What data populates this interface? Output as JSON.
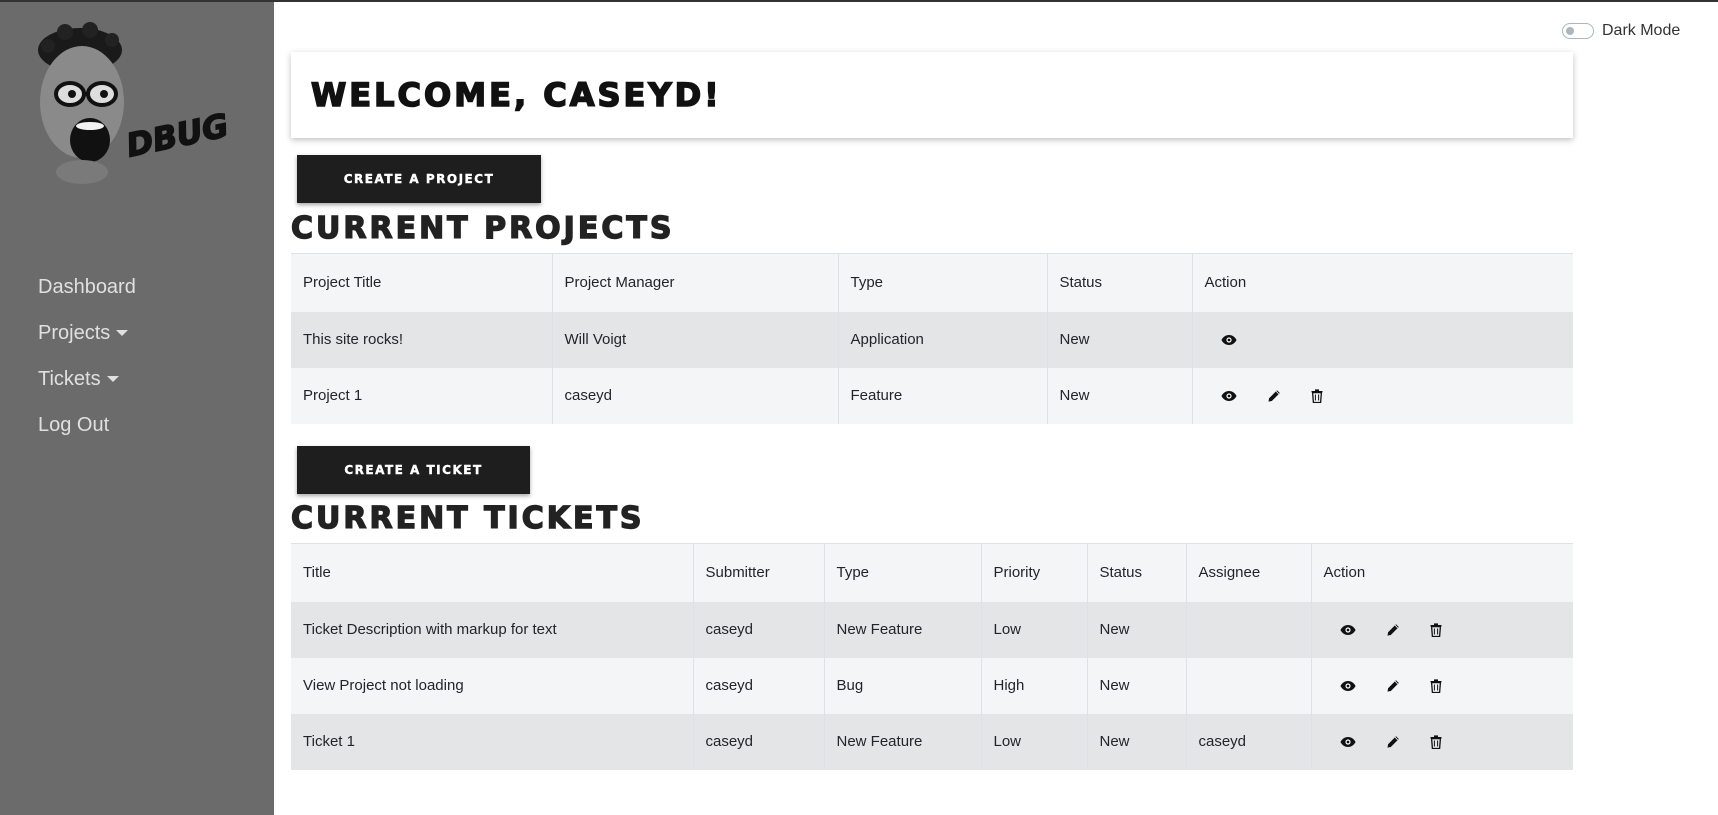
{
  "brand": {
    "logo_text": "DBUG"
  },
  "sidebar": {
    "items": [
      {
        "label": "Dashboard",
        "dropdown": false
      },
      {
        "label": "Projects",
        "dropdown": true
      },
      {
        "label": "Tickets",
        "dropdown": true
      },
      {
        "label": "Log Out",
        "dropdown": false
      }
    ]
  },
  "header": {
    "dark_mode_label": "Dark Mode",
    "dark_mode_on": false
  },
  "welcome": {
    "text": "WELCOME, CASEYD!"
  },
  "projects": {
    "create_label": "CREATE A PROJECT",
    "title": "CURRENT PROJECTS",
    "columns": [
      "Project Title",
      "Project Manager",
      "Type",
      "Status",
      "Action"
    ],
    "rows": [
      {
        "title": "This site rocks!",
        "manager": "Will Voigt",
        "type": "Application",
        "status": "New",
        "actions": [
          "view-icon"
        ]
      },
      {
        "title": "Project 1",
        "manager": "caseyd",
        "type": "Feature",
        "status": "New",
        "actions": [
          "view-icon",
          "edit-icon",
          "delete-icon"
        ]
      }
    ]
  },
  "tickets": {
    "create_label": "CREATE A TICKET",
    "title": "CURRENT TICKETS",
    "columns": [
      "Title",
      "Submitter",
      "Type",
      "Priority",
      "Status",
      "Assignee",
      "Action"
    ],
    "rows": [
      {
        "title": "Ticket Description with markup for text",
        "submitter": "caseyd",
        "type": "New Feature",
        "priority": "Low",
        "status": "New",
        "assignee": "",
        "actions": [
          "view-icon",
          "edit-icon",
          "delete-icon"
        ]
      },
      {
        "title": "View Project not loading",
        "submitter": "caseyd",
        "type": "Bug",
        "priority": "High",
        "status": "New",
        "assignee": "",
        "actions": [
          "view-icon",
          "edit-icon",
          "delete-icon"
        ]
      },
      {
        "title": "Ticket 1",
        "submitter": "caseyd",
        "type": "New Feature",
        "priority": "Low",
        "status": "New",
        "assignee": "caseyd",
        "actions": [
          "view-icon",
          "edit-icon",
          "delete-icon"
        ]
      }
    ]
  },
  "colors": {
    "sidebar_bg": "#6b6b6b",
    "button_bg": "#1e1e1e",
    "row_dark": "#e4e5e7",
    "row_light": "#f4f5f7"
  }
}
